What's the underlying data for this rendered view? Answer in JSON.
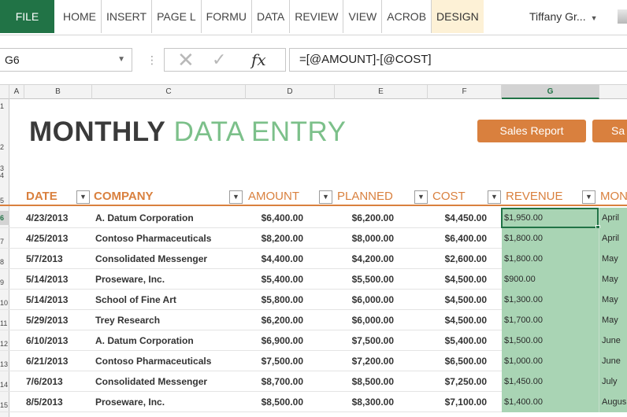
{
  "ribbon": {
    "file_label": "FILE",
    "tabs": [
      "HOME",
      "INSERT",
      "PAGE L",
      "FORMU",
      "DATA",
      "REVIEW",
      "VIEW",
      "ACROB",
      "DESIGN"
    ],
    "user_name": "Tiffany Gr..."
  },
  "formula_bar": {
    "name_box": "G6",
    "formula": "=[@AMOUNT]-[@COST]",
    "fx_label": "fx"
  },
  "columns": [
    "A",
    "B",
    "C",
    "D",
    "E",
    "F",
    "G"
  ],
  "row_numbers": [
    "1",
    "2",
    "3",
    "4",
    "5",
    "6",
    "7",
    "8",
    "9",
    "10",
    "11",
    "12",
    "13",
    "14",
    "15"
  ],
  "title": {
    "bold_part": "MONTHLY",
    "light_part": "DATA ENTRY"
  },
  "buttons": {
    "sales_report": "Sales Report",
    "second": "Sa"
  },
  "headers": [
    "DATE",
    "COMPANY",
    "AMOUNT",
    "PLANNED",
    "COST",
    "REVENUE",
    "MON"
  ],
  "rows": [
    [
      "4/23/2013",
      "A. Datum Corporation",
      "$6,400.00",
      "$6,200.00",
      "$4,450.00",
      "$1,950.00",
      "April"
    ],
    [
      "4/25/2013",
      "Contoso Pharmaceuticals",
      "$8,200.00",
      "$8,000.00",
      "$6,400.00",
      "$1,800.00",
      "April"
    ],
    [
      "5/7/2013",
      "Consolidated Messenger",
      "$4,400.00",
      "$4,200.00",
      "$2,600.00",
      "$1,800.00",
      "May"
    ],
    [
      "5/14/2013",
      "Proseware, Inc.",
      "$5,400.00",
      "$5,500.00",
      "$4,500.00",
      "$900.00",
      "May"
    ],
    [
      "5/14/2013",
      "School of Fine Art",
      "$5,800.00",
      "$6,000.00",
      "$4,500.00",
      "$1,300.00",
      "May"
    ],
    [
      "5/29/2013",
      "Trey Research",
      "$6,200.00",
      "$6,000.00",
      "$4,500.00",
      "$1,700.00",
      "May"
    ],
    [
      "6/10/2013",
      "A. Datum Corporation",
      "$6,900.00",
      "$7,500.00",
      "$5,400.00",
      "$1,500.00",
      "June"
    ],
    [
      "6/21/2013",
      "Contoso Pharmaceuticals",
      "$7,500.00",
      "$7,200.00",
      "$6,500.00",
      "$1,000.00",
      "June"
    ],
    [
      "7/6/2013",
      "Consolidated Messenger",
      "$8,700.00",
      "$8,500.00",
      "$7,250.00",
      "$1,450.00",
      "July"
    ],
    [
      "8/5/2013",
      "Proseware, Inc.",
      "$8,500.00",
      "$8,300.00",
      "$7,100.00",
      "$1,400.00",
      "Augus"
    ]
  ],
  "selected": {
    "column": "G",
    "row": "6"
  },
  "colors": {
    "excel_green": "#217346",
    "accent_orange": "#d9803e",
    "title_green": "#7cc08a",
    "revenue_fill": "#a9d4b4"
  }
}
